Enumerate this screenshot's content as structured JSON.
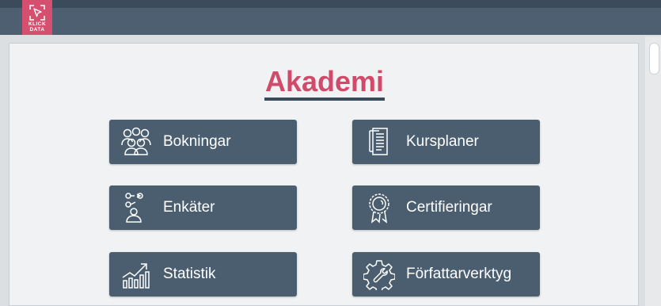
{
  "logo": {
    "line1": "KLICK",
    "line2": "DATA"
  },
  "page": {
    "title": "Akademi"
  },
  "tiles": [
    {
      "label": "Bokningar",
      "icon": "people-group-icon"
    },
    {
      "label": "Kursplaner",
      "icon": "document-stack-icon"
    },
    {
      "label": "Enkäter",
      "icon": "survey-person-icon"
    },
    {
      "label": "Certifieringar",
      "icon": "award-badge-icon"
    },
    {
      "label": "Statistik",
      "icon": "bar-chart-trend-icon"
    },
    {
      "label": "Författarverktyg",
      "icon": "gear-tool-icon"
    }
  ],
  "colors": {
    "accent": "#d14a6a",
    "tile": "#4a5e70",
    "header": "#4d5f71"
  }
}
